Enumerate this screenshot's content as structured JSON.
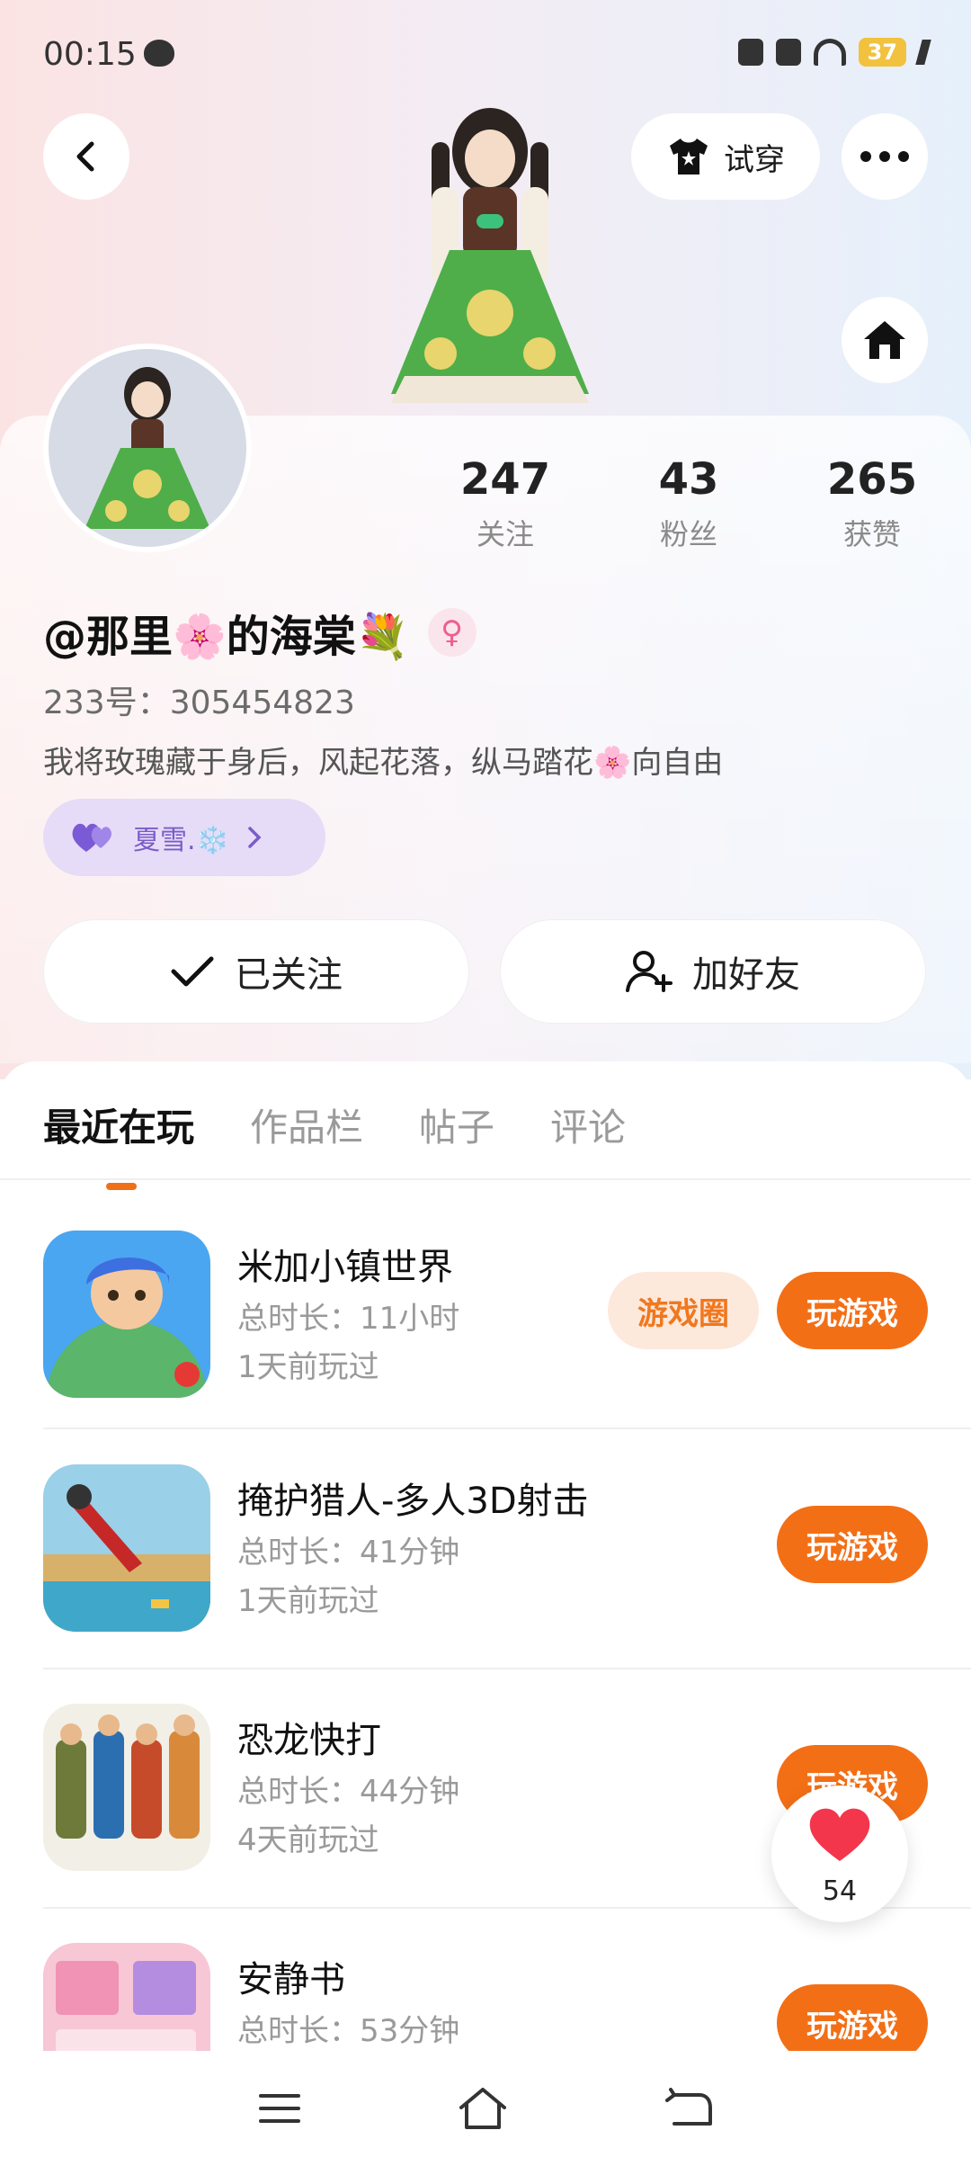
{
  "status_bar": {
    "time": "00:15",
    "battery": "37"
  },
  "header": {
    "tryon_label": "试穿"
  },
  "stats": [
    {
      "num": "247",
      "label": "关注"
    },
    {
      "num": "43",
      "label": "粉丝"
    },
    {
      "num": "265",
      "label": "获赞"
    }
  ],
  "profile": {
    "name": "@那里🌸的海棠💐",
    "gender_symbol": "♀",
    "uid": "233号：305454823",
    "bio": "我将玫瑰藏于身后，风起花落，纵马踏花🌸向自由",
    "cp_pill": "夏雪.❄️"
  },
  "actions": {
    "follow_label": "已关注",
    "add_friend_label": "加好友"
  },
  "tabs": [
    {
      "label": "最近在玩"
    },
    {
      "label": "作品栏"
    },
    {
      "label": "帖子"
    },
    {
      "label": "评论"
    }
  ],
  "games": [
    {
      "title": "米加小镇世界",
      "duration": "总时长：11小时",
      "last_played": "1天前玩过",
      "circle_label": "游戏圈",
      "play_label": "玩游戏"
    },
    {
      "title": "掩护猎人-多人3D射击",
      "duration": "总时长：41分钟",
      "last_played": "1天前玩过",
      "play_label": "玩游戏"
    },
    {
      "title": "恐龙快打",
      "duration": "总时长：44分钟",
      "last_played": "4天前玩过",
      "play_label": "玩游戏"
    },
    {
      "title": "安静书",
      "duration": "总时长：53分钟",
      "play_label": "玩游戏"
    }
  ],
  "like": {
    "count": "54"
  },
  "colors": {
    "accent": "#f36f16",
    "accent_soft": "#fde8dc",
    "pill_bg": "#e6dcf7"
  }
}
